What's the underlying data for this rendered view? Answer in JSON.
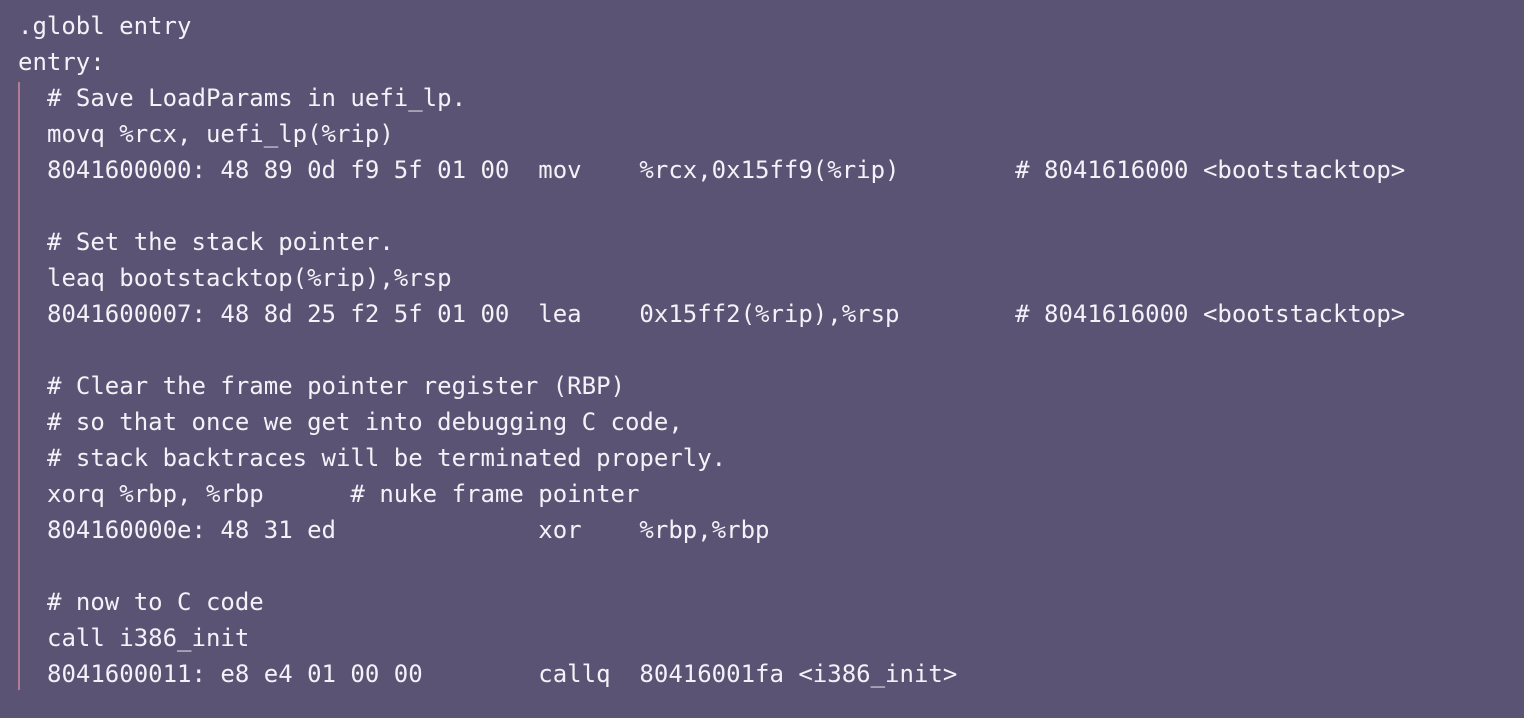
{
  "code": {
    "header": [
      ".globl entry",
      "entry:"
    ],
    "body": [
      "# Save LoadParams in uefi_lp.",
      "movq %rcx, uefi_lp(%rip)",
      "8041600000: 48 89 0d f9 5f 01 00  mov    %rcx,0x15ff9(%rip)        # 8041616000 <bootstacktop>",
      "",
      "# Set the stack pointer.",
      "leaq bootstacktop(%rip),%rsp",
      "8041600007: 48 8d 25 f2 5f 01 00  lea    0x15ff2(%rip),%rsp        # 8041616000 <bootstacktop>",
      "",
      "# Clear the frame pointer register (RBP)",
      "# so that once we get into debugging C code,",
      "# stack backtraces will be terminated properly.",
      "xorq %rbp, %rbp      # nuke frame pointer",
      "804160000e: 48 31 ed              xor    %rbp,%rbp",
      "",
      "# now to C code",
      "call i386_init",
      "8041600011: e8 e4 01 00 00        callq  80416001fa <i386_init>"
    ]
  },
  "colors": {
    "background": "#5a5374",
    "text": "#f4f2f8",
    "nest_bar": "#b07d94"
  }
}
